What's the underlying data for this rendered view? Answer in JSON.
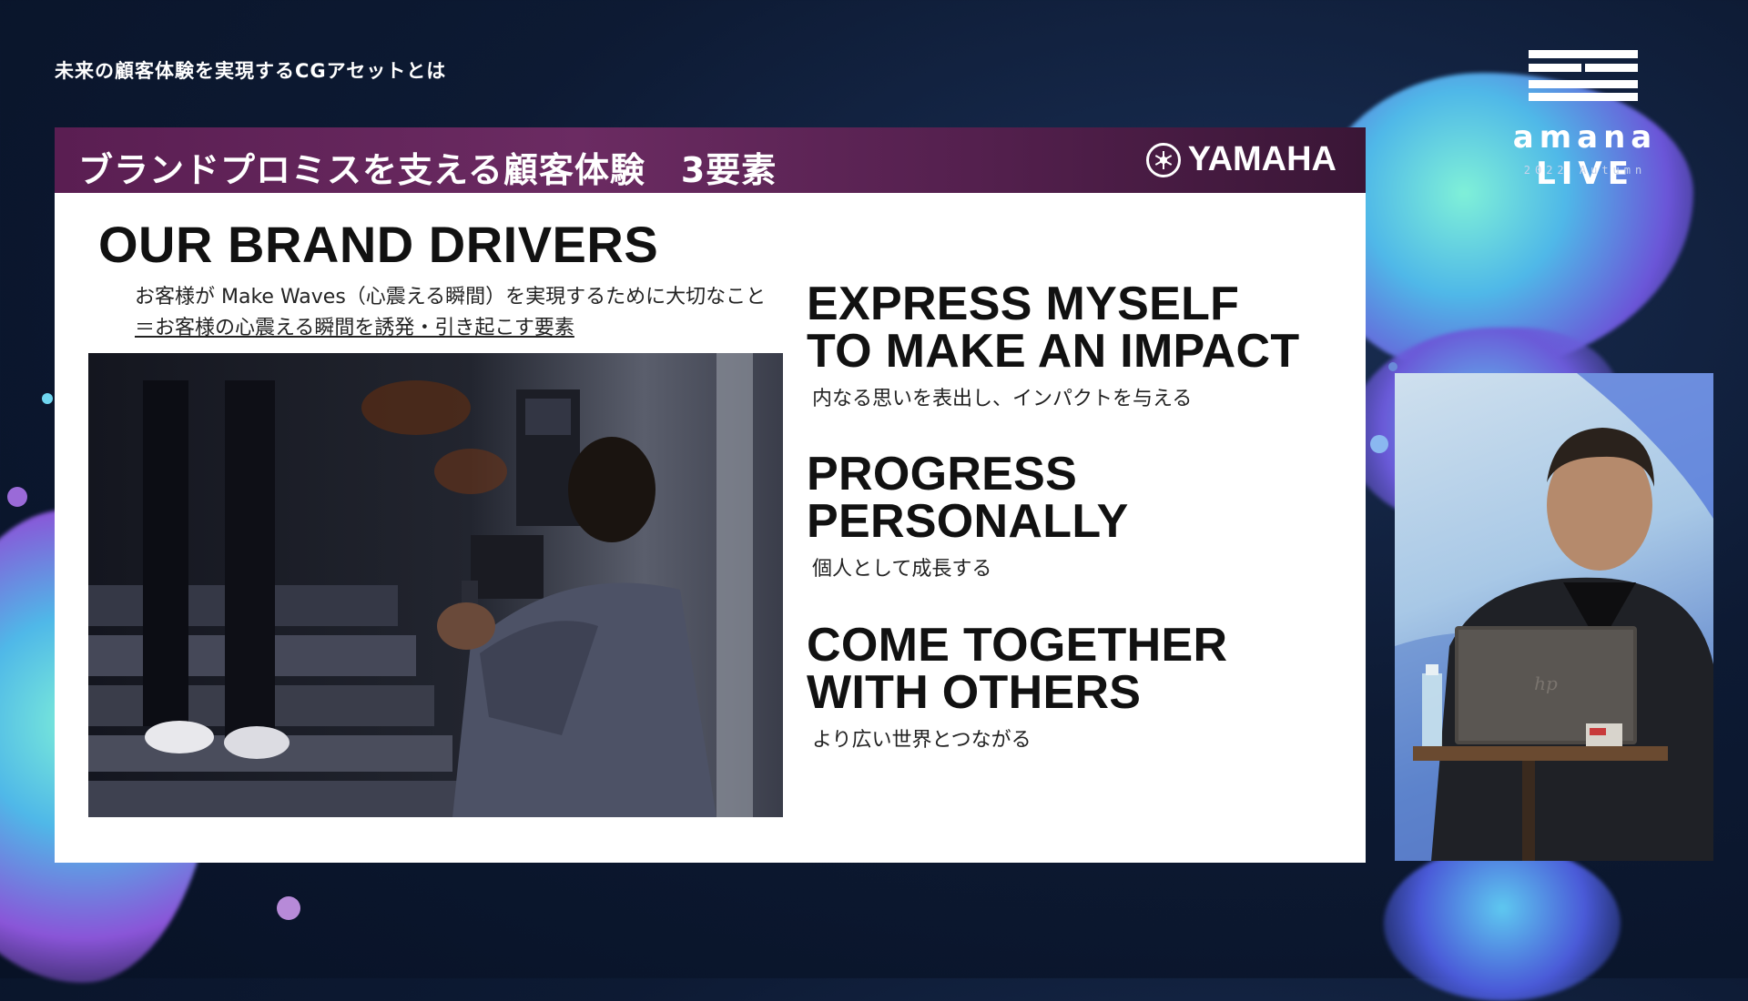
{
  "stream": {
    "title": "未来の顧客体験を実現するCGアセットとは"
  },
  "logo": {
    "name": "amana LIVE",
    "subtitle": "2022 Autumn"
  },
  "slide": {
    "header_title": "ブランドプロミスを支える顧客体験　3要素",
    "brand": "YAMAHA",
    "heading": "OUR BRAND DRIVERS",
    "sub_line_1": "お客様が Make Waves（心震える瞬間）を実現するために大切なこと",
    "sub_line_2": "＝お客様の心震える瞬間を誘発・引き起こす要素",
    "drivers": [
      {
        "en_line_1": "EXPRESS MYSELF",
        "en_line_2": "TO MAKE AN IMPACT",
        "jp": "内なる思いを表出し、インパクトを与える"
      },
      {
        "en_line_1": "PROGRESS",
        "en_line_2": "PERSONALLY",
        "jp": "個人として成長する"
      },
      {
        "en_line_1": "COME TOGETHER",
        "en_line_2": "WITH OTHERS",
        "jp": "より広い世界とつながる"
      }
    ]
  },
  "colors": {
    "header_purple": "#5a1e52",
    "background_navy": "#0d1a33",
    "blob_cyan": "#7ff0d8",
    "blob_violet": "#6b55d8"
  },
  "icons": {
    "yamaha_mark": "yamaha-tuning-fork-icon",
    "laptop_brand": "hp-logo-icon"
  }
}
